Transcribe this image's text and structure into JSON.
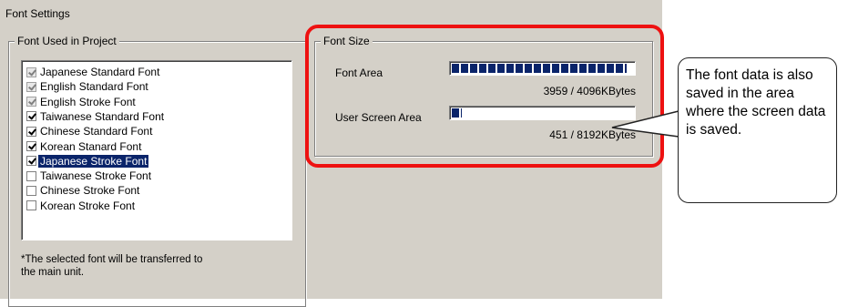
{
  "window": {
    "title": "Font Settings"
  },
  "font_used": {
    "label": "Font Used in Project",
    "items": [
      {
        "label": "Japanese Standard Font",
        "checked": true,
        "disabled": true,
        "selected": false
      },
      {
        "label": "English Standard Font",
        "checked": true,
        "disabled": true,
        "selected": false
      },
      {
        "label": "English Stroke Font",
        "checked": true,
        "disabled": true,
        "selected": false
      },
      {
        "label": "Taiwanese Standard Font",
        "checked": true,
        "disabled": false,
        "selected": false
      },
      {
        "label": "Chinese Standard Font",
        "checked": true,
        "disabled": false,
        "selected": false
      },
      {
        "label": "Korean Stanard Font",
        "checked": true,
        "disabled": false,
        "selected": false
      },
      {
        "label": "Japanese Stroke Font",
        "checked": true,
        "disabled": false,
        "selected": true
      },
      {
        "label": "Taiwanese Stroke Font",
        "checked": false,
        "disabled": false,
        "selected": false
      },
      {
        "label": "Chinese Stroke Font",
        "checked": false,
        "disabled": false,
        "selected": false
      },
      {
        "label": "Korean Stroke Font",
        "checked": false,
        "disabled": false,
        "selected": false
      }
    ],
    "note_line1": "*The selected font will be transferred to",
    "note_line2": "the main unit."
  },
  "font_size": {
    "label": "Font Size",
    "font_area": {
      "label": "Font Area",
      "value_text": "3959 / 4096KBytes",
      "fraction": 0.967
    },
    "user_screen_area": {
      "label": "User Screen Area",
      "value_text": "451 / 8192KBytes",
      "fraction": 0.055
    }
  },
  "callout": {
    "text": "The font data is also saved in the area where the screen data is saved."
  },
  "colors": {
    "selection": "#0a246a",
    "highlight": "#ee1111",
    "panel": "#d4d0c8"
  }
}
